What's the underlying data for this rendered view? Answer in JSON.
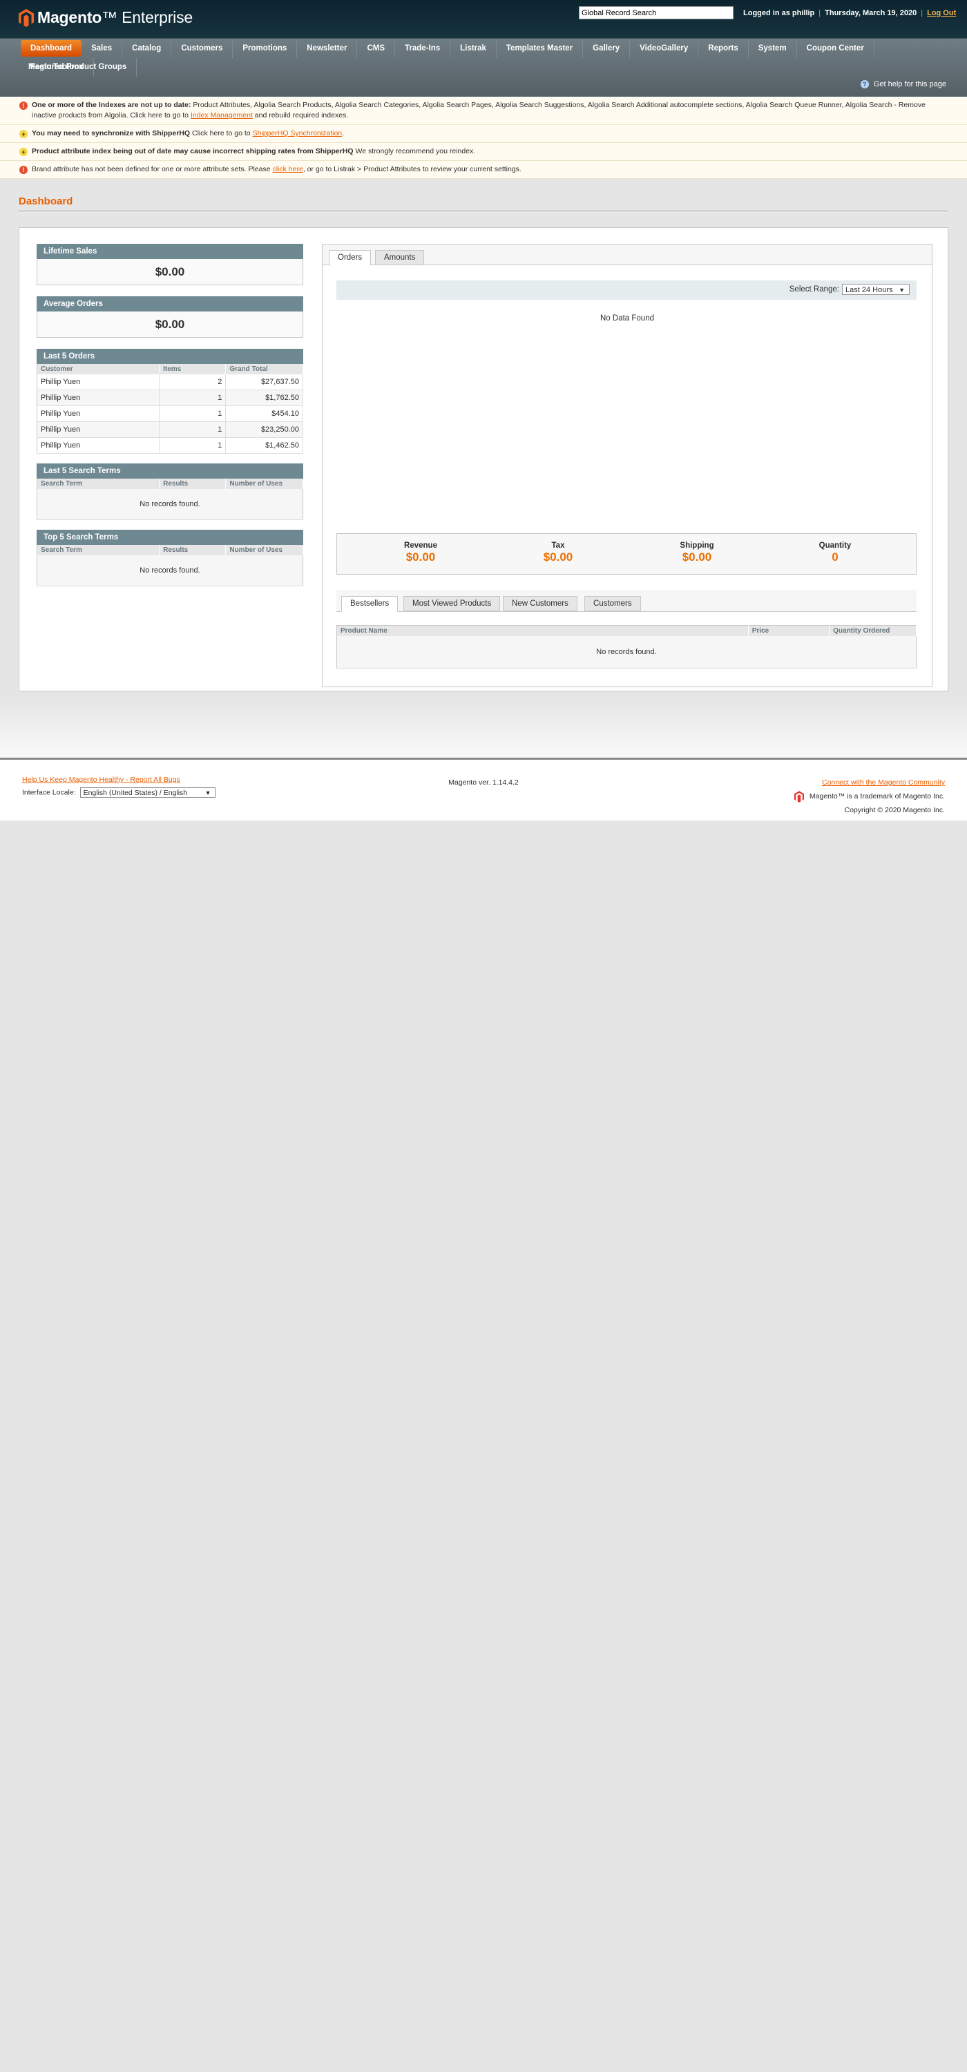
{
  "header": {
    "brand_bold": "Magento",
    "brand_light": "Enterprise",
    "search_value": "Global Record Search",
    "logged_in": "Logged in as phillip",
    "date": "Thursday, March 19, 2020",
    "logout": "Log Out"
  },
  "nav": {
    "items": [
      "Dashboard",
      "Sales",
      "Catalog",
      "Customers",
      "Promotions",
      "Newsletter",
      "CMS",
      "Trade-Ins",
      "Listrak",
      "Templates Master",
      "Gallery",
      "VideoGallery",
      "Reports",
      "System",
      "Coupon Center",
      "Magic Toolbox"
    ],
    "row2": "Featured Product Groups",
    "help": "Get help for this page"
  },
  "notices": [
    {
      "type": "error",
      "bold": "One or more of the Indexes are not up to date:",
      "text": " Product Attributes, Algolia Search Products, Algolia Search Categories, Algolia Search Pages, Algolia Search Suggestions, Algolia Search Additional autocomplete sections, Algolia Search Queue Runner, Algolia Search - Remove inactive products from Algolia. Click here to go to ",
      "link": "Index Management",
      "after": " and rebuild required indexes."
    },
    {
      "type": "warning",
      "bold": "You may need to synchronize with ShipperHQ",
      "text": " Click here to go to ",
      "link": "ShipperHQ Synchronization",
      "after": "."
    },
    {
      "type": "warning",
      "bold": "Product attribute index being out of date may cause incorrect shipping rates from ShipperHQ",
      "text": " We strongly recommend you reindex.",
      "link": "",
      "after": ""
    },
    {
      "type": "error",
      "bold": "",
      "text": "Brand attribute has not been defined for one or more attribute sets. Please ",
      "link": "click here",
      "after": ", or go to Listrak > Product Attributes to review your current settings."
    }
  ],
  "page": {
    "title": "Dashboard"
  },
  "lifetime_sales": {
    "title": "Lifetime Sales",
    "value": "$0.00"
  },
  "average_orders": {
    "title": "Average Orders",
    "value": "$0.00"
  },
  "last_orders": {
    "title": "Last 5 Orders",
    "columns": [
      "Customer",
      "Items",
      "Grand Total"
    ],
    "rows": [
      [
        "Phillip Yuen",
        "2",
        "$27,637.50"
      ],
      [
        "Phillip Yuen",
        "1",
        "$1,762.50"
      ],
      [
        "Phillip Yuen",
        "1",
        "$454.10"
      ],
      [
        "Phillip Yuen",
        "1",
        "$23,250.00"
      ],
      [
        "Phillip Yuen",
        "1",
        "$1,462.50"
      ]
    ]
  },
  "last_search": {
    "title": "Last 5 Search Terms",
    "columns": [
      "Search Term",
      "Results",
      "Number of Uses"
    ],
    "empty": "No records found."
  },
  "top_search": {
    "title": "Top 5 Search Terms",
    "columns": [
      "Search Term",
      "Results",
      "Number of Uses"
    ],
    "empty": "No records found."
  },
  "chart_panel": {
    "tabs": [
      "Orders",
      "Amounts"
    ],
    "range_label": "Select Range:",
    "range_value": "Last 24 Hours",
    "no_data": "No Data Found"
  },
  "totals": [
    {
      "label": "Revenue",
      "value": "$0.00"
    },
    {
      "label": "Tax",
      "value": "$0.00"
    },
    {
      "label": "Shipping",
      "value": "$0.00"
    },
    {
      "label": "Quantity",
      "value": "0"
    }
  ],
  "products_panel": {
    "tabs": [
      "Bestsellers",
      "Most Viewed Products",
      "New Customers",
      "Customers"
    ],
    "columns": [
      "Product Name",
      "Price",
      "Quantity Ordered"
    ],
    "empty": "No records found."
  },
  "footer": {
    "report_bugs": "Help Us Keep Magento Healthy - Report All Bugs",
    "locale_label": "Interface Locale:",
    "locale_value": "English (United States) / English",
    "version": "Magento ver. 1.14.4.2",
    "community": "Connect with the Magento Community",
    "trademark": "Magento™ is a trademark of Magento Inc.",
    "copyright": "Copyright © 2020 Magento Inc."
  },
  "colors": {
    "accent": "#eb5e00",
    "header_bg": "#0b2530",
    "nav_bg": "#5f6c72",
    "section_head": "#6f8992"
  }
}
